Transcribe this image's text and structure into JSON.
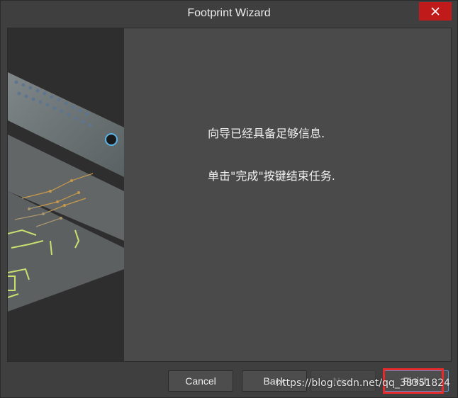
{
  "window": {
    "title": "Footprint Wizard"
  },
  "icons": {
    "close": "close-icon"
  },
  "message": {
    "line1": "向导已经具备足够信息.",
    "line2": "单击\"完成\"按键结束任务."
  },
  "buttons": {
    "cancel": "Cancel",
    "back": "Back",
    "next": "Next",
    "finish": "Finish"
  },
  "watermark": "https://blog.csdn.net/qq_38351824",
  "colors": {
    "close_button": "#c01a1a",
    "highlight": "#e82a2a",
    "pcb_trace": "#c8e070",
    "pcb_pad": "#c99a4a"
  }
}
